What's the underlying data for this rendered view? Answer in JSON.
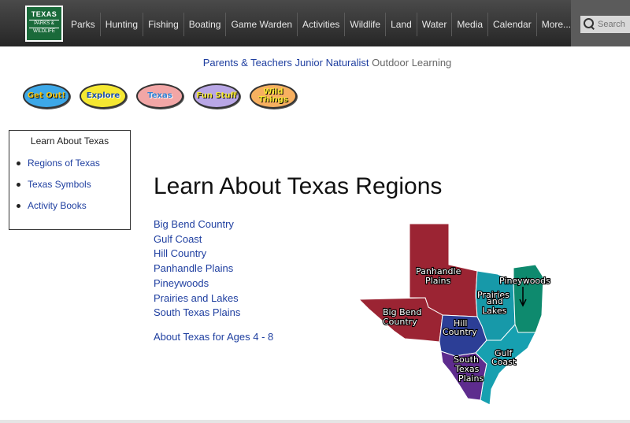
{
  "logo": {
    "line1": "TEXAS",
    "line2": "PARKS &",
    "line3": "WILDLIFE"
  },
  "nav": [
    {
      "label": "Parks"
    },
    {
      "label": "Hunting"
    },
    {
      "label": "Fishing"
    },
    {
      "label": "Boating"
    },
    {
      "label": "Game Warden"
    },
    {
      "label": "Activities"
    },
    {
      "label": "Wildlife"
    },
    {
      "label": "Land"
    },
    {
      "label": "Water"
    },
    {
      "label": "Media"
    },
    {
      "label": "Calendar"
    },
    {
      "label": "More..."
    }
  ],
  "search": {
    "placeholder": "Search"
  },
  "breadcrumb": {
    "parents_teachers": "Parents & Teachers",
    "junior_naturalist": "Junior Naturalist",
    "outdoor_learning": "Outdoor Learning"
  },
  "pills": [
    {
      "label": "Get Out!"
    },
    {
      "label": "Explore"
    },
    {
      "label": "Texas"
    },
    {
      "label": "Fun Stuff"
    },
    {
      "label": "Wild Things"
    }
  ],
  "sidebar": {
    "title": "Learn About Texas",
    "items": [
      {
        "label": "Regions of Texas"
      },
      {
        "label": "Texas Symbols"
      },
      {
        "label": "Activity Books"
      }
    ]
  },
  "main": {
    "title": "Learn About Texas Regions",
    "regions": [
      "Big Bend Country",
      "Gulf Coast",
      "Hill Country",
      "Panhandle Plains",
      "Pineywoods",
      "Prairies and Lakes",
      "South Texas Plains"
    ],
    "ages_link": "About Texas for Ages 4 - 8"
  },
  "map": {
    "labels": {
      "panhandle": [
        "Panhandle",
        "Plains"
      ],
      "pineywoods": [
        "Pineywoods"
      ],
      "prairies": [
        "Prairies",
        "and",
        "Lakes"
      ],
      "bigbend": [
        "Big Bend",
        "Country"
      ],
      "hill": [
        "Hill",
        "Country"
      ],
      "gulf": [
        "Gulf",
        "Coast"
      ],
      "south": [
        "South",
        "Texas",
        "Plains"
      ]
    },
    "colors": {
      "panhandle": "#9b2433",
      "bigbend": "#9b2433",
      "hill": "#2c3e96",
      "prairies": "#1799a9",
      "pineywoods": "#0e8a6e",
      "gulf": "#17a0b0",
      "south": "#5e2c8e"
    }
  }
}
